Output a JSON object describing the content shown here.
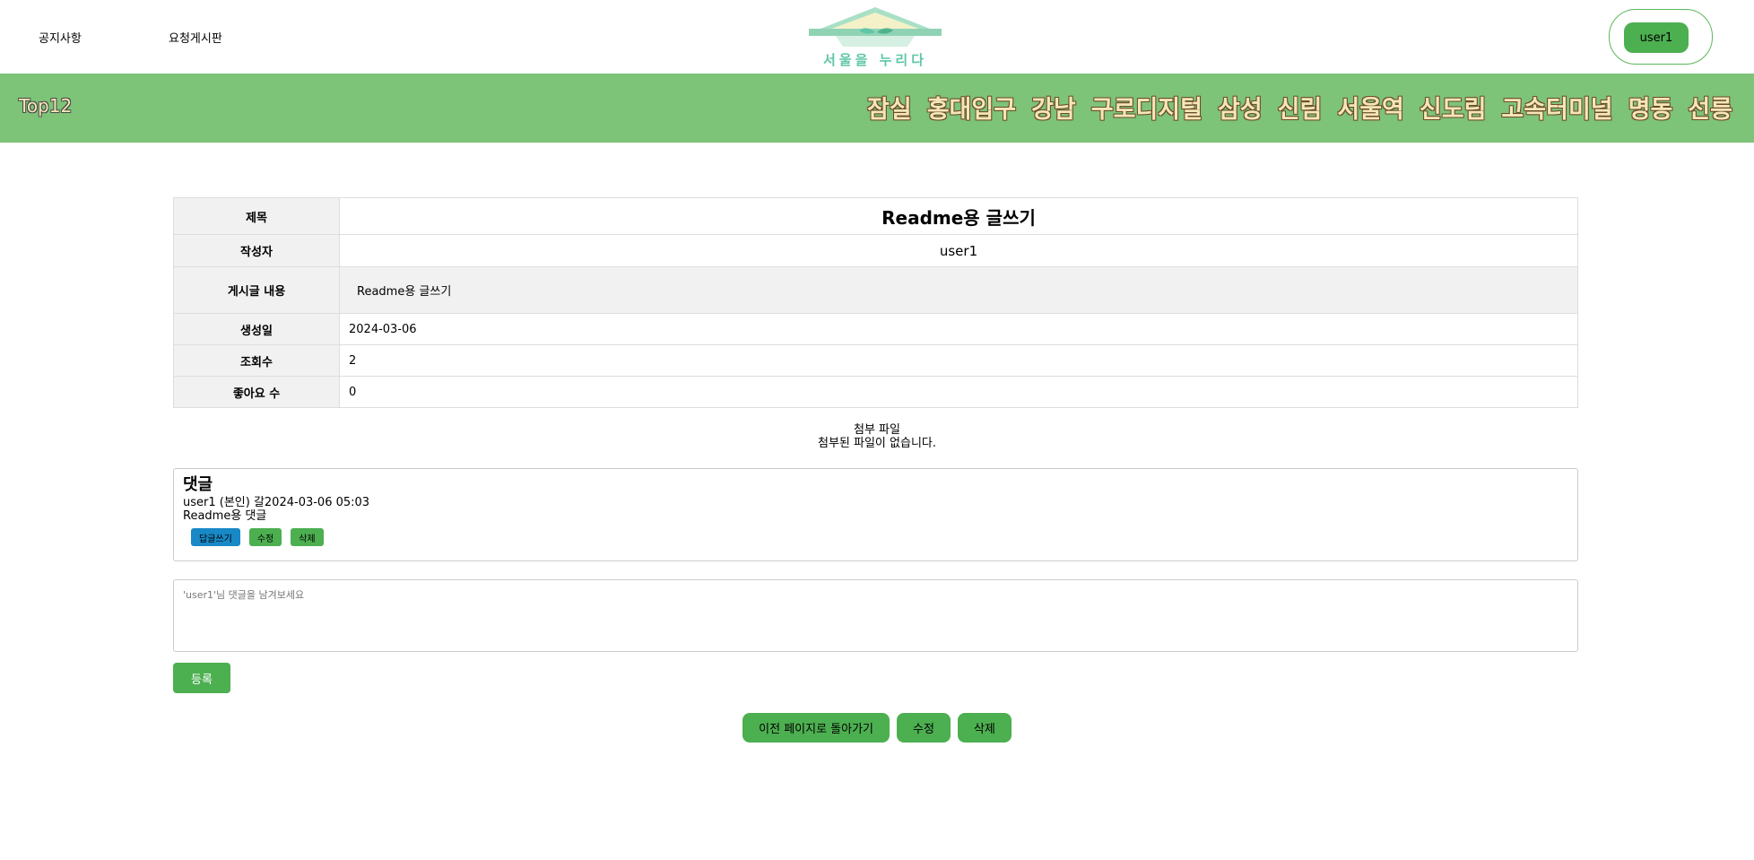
{
  "nav": {
    "notice_label": "공지사항",
    "request_board_label": "요청게시판",
    "logo_text": "서울을 누리다",
    "user_label": "user1"
  },
  "bar": {
    "brand": "Top12",
    "districts": [
      "잠실",
      "홍대입구",
      "강남",
      "구로디지털",
      "삼성",
      "신림",
      "서울역",
      "신도림",
      "고속터미널",
      "명동",
      "선릉"
    ]
  },
  "post": {
    "title_label": "제목",
    "title_value": "Readme용 글쓰기",
    "author_label": "작성자",
    "author_value": "user1",
    "content_label": "게시글 내용",
    "content_value": "Readme용 글쓰기",
    "created_label": "생성일",
    "created_value": "2024-03-06",
    "views_label": "조회수",
    "views_value": "2",
    "likes_label": "좋아요 수",
    "likes_value": "0"
  },
  "attachments": {
    "title": "첨부 파일",
    "empty_text": "첨부된 파일이 없습니다."
  },
  "comments": {
    "heading": "댓글",
    "items": [
      {
        "meta": "user1 (본인) 갈2024-03-06 05:03",
        "text": "Readme용 댓글",
        "reply_label": "답글쓰기",
        "edit_label": "수정",
        "delete_label": "삭제"
      }
    ]
  },
  "comment_form": {
    "placeholder": "'user1'님 댓글을 남겨보세요",
    "submit_label": "등록"
  },
  "actions": {
    "back_label": "이전 페이지로 돌아가기",
    "edit_label": "수정",
    "delete_label": "삭제"
  },
  "colors": {
    "bar_green": "#7dc378",
    "button_green": "#4caf50",
    "reply_blue": "#1888c6",
    "district_text": "#f5e7b5"
  }
}
